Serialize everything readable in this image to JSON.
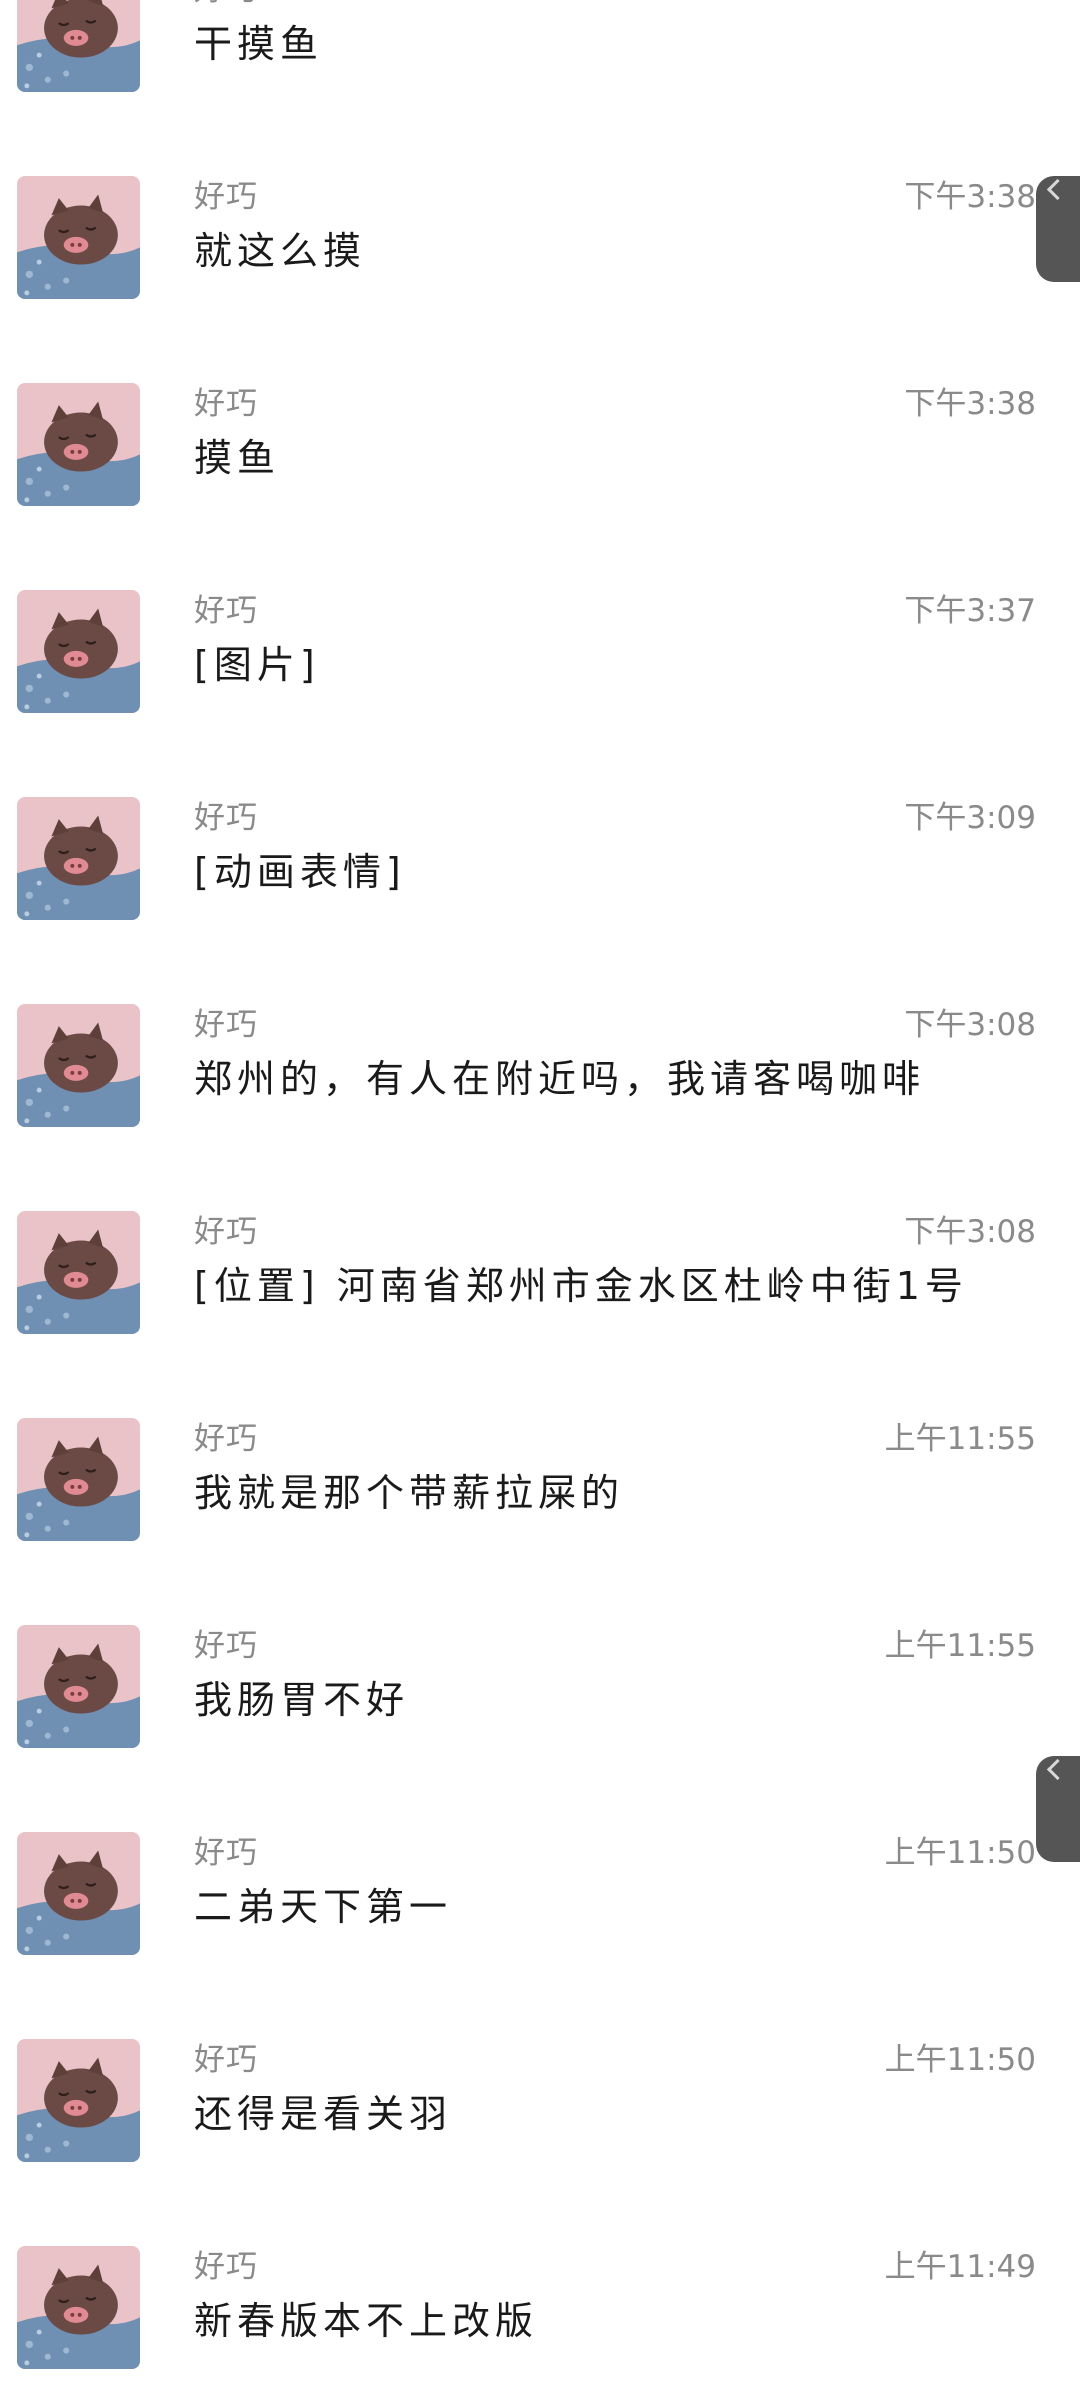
{
  "colors": {
    "background": "#ffffff",
    "sender_text": "#8a8a8a",
    "time_text": "#8a8a8a",
    "message_text": "#1a1a1a",
    "edge_tab": "#555555"
  },
  "avatar_icon": "pig-sleeping-avatar-icon",
  "conversations": [
    {
      "sender": "好巧",
      "time": "",
      "message": "干摸鱼"
    },
    {
      "sender": "好巧",
      "time": "下午3:38",
      "message": "就这么摸"
    },
    {
      "sender": "好巧",
      "time": "下午3:38",
      "message": "摸鱼"
    },
    {
      "sender": "好巧",
      "time": "下午3:37",
      "message": "[图片]"
    },
    {
      "sender": "好巧",
      "time": "下午3:09",
      "message": "[动画表情]"
    },
    {
      "sender": "好巧",
      "time": "下午3:08",
      "message": "郑州的，有人在附近吗，我请客喝咖啡"
    },
    {
      "sender": "好巧",
      "time": "下午3:08",
      "message": "[位置] 河南省郑州市金水区杜岭中街1号"
    },
    {
      "sender": "好巧",
      "time": "上午11:55",
      "message": "我就是那个带薪拉屎的"
    },
    {
      "sender": "好巧",
      "time": "上午11:55",
      "message": "我肠胃不好"
    },
    {
      "sender": "好巧",
      "time": "上午11:50",
      "message": "二弟天下第一"
    },
    {
      "sender": "好巧",
      "time": "上午11:50",
      "message": "还得是看关羽"
    },
    {
      "sender": "好巧",
      "time": "上午11:49",
      "message": "新春版本不上改版"
    }
  ]
}
